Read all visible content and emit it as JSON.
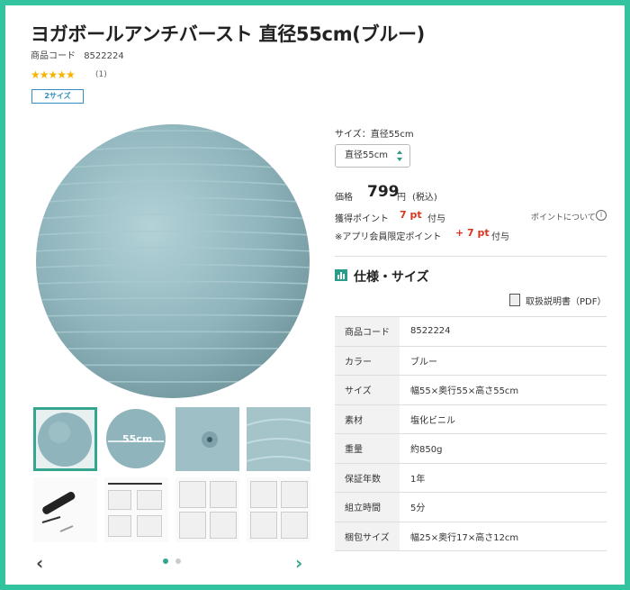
{
  "product": {
    "title": "ヨガボールアンチバースト 直径55cm(ブルー)",
    "code_label": "商品コード",
    "code_value": "8522224",
    "stars": "★★★★★",
    "review_count": "(1)",
    "size_badge": "2サイズ"
  },
  "options": {
    "size_label": "サイズ：直径55cm",
    "size_selected": "直径55cm"
  },
  "price": {
    "label": "価格",
    "value": "799",
    "unit": "円",
    "tax": "(税込)"
  },
  "points": {
    "label": "獲得ポイント",
    "value": "7 pt",
    "suffix": "付与",
    "link": "ポイントについて",
    "app_label": "※アプリ会員限定ポイント",
    "app_value": "+ 7 pt",
    "app_suffix": "付与"
  },
  "spec": {
    "heading": "仕様・サイズ",
    "manual_link": "取扱説明書（PDF）",
    "rows": [
      {
        "key": "商品コード",
        "value": "8522224"
      },
      {
        "key": "カラー",
        "value": "ブルー"
      },
      {
        "key": "サイズ",
        "value": "幅55×奥行55×高さ55cm"
      },
      {
        "key": "素材",
        "value": "塩化ビニル"
      },
      {
        "key": "重量",
        "value": "約850g"
      },
      {
        "key": "保証年数",
        "value": "1年"
      },
      {
        "key": "組立時間",
        "value": "5分"
      },
      {
        "key": "梱包サイズ",
        "value": "幅25×奥行17×高さ12cm"
      }
    ]
  },
  "gallery": {
    "thumb_label": "55cm",
    "prev_icon": "chevron-left-icon",
    "next_icon": "chevron-right-icon"
  },
  "colors": {
    "accent": "#33c49f",
    "ball": "#8fb4bc",
    "point_red": "#d9341f"
  }
}
